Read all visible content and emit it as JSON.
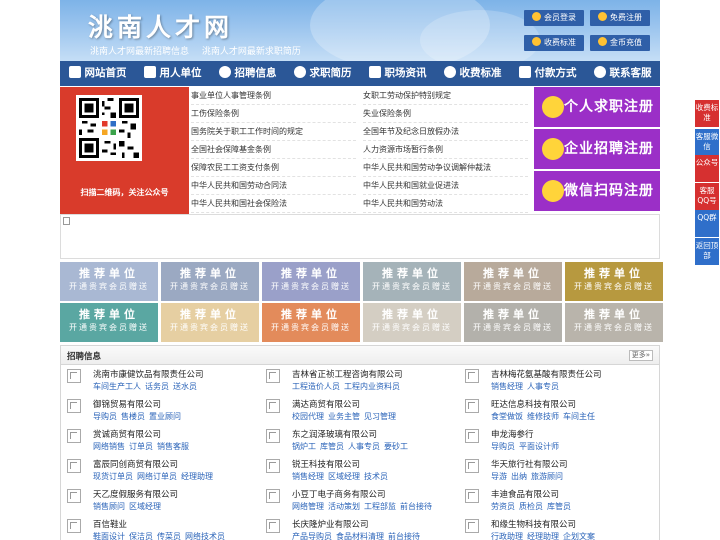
{
  "header": {
    "site_title": "洮南人才网",
    "subtitle_links": [
      "洮南人才网最新招聘信息",
      "洮南人才网最新求职简历"
    ],
    "buttons": [
      "会员登录",
      "免费注册",
      "收费标准",
      "金币充值"
    ]
  },
  "nav": {
    "items": [
      {
        "label": "网站首页",
        "icon": "home-icon"
      },
      {
        "label": "用人单位",
        "icon": "building-icon"
      },
      {
        "label": "招聘信息",
        "icon": "broadcast-icon"
      },
      {
        "label": "求职简历",
        "icon": "search-icon"
      },
      {
        "label": "职场资讯",
        "icon": "news-icon"
      },
      {
        "label": "收费标准",
        "icon": "money-icon"
      },
      {
        "label": "付款方式",
        "icon": "card-icon"
      },
      {
        "label": "联系客服",
        "icon": "phone-icon"
      }
    ]
  },
  "qr": {
    "caption": "扫描二维码，关注公众号"
  },
  "regulations": {
    "left": [
      "事业单位人事管理条例",
      "工伤保险条例",
      "国务院关于职工工作时间的规定",
      "全国社会保障基金条例",
      "保障农民工工资支付条例",
      "中华人民共和国劳动合同法",
      "中华人民共和国社会保险法"
    ],
    "right": [
      "女职工劳动保护特别规定",
      "失业保险条例",
      "全国年节及纪念日放假办法",
      "人力资源市场暂行条例",
      "中华人民共和国劳动争议调解仲裁法",
      "中华人民共和国就业促进法",
      "中华人民共和国劳动法"
    ]
  },
  "register_buttons": [
    "个人求职注册",
    "企业招聘注册",
    "微信扫码注册"
  ],
  "promo": {
    "title": "推荐单位",
    "sub": "开通贵宾会员赠送",
    "colors_row1": [
      "#a9b8d3",
      "#9ba9c2",
      "#9aa0c9",
      "#a5b3b9",
      "#b8aa9b",
      "#b7993f"
    ],
    "colors_row2": [
      "#5aa7a2",
      "#e6cfa2",
      "#e38b5b",
      "#d4cec3",
      "#b3b1ab",
      "#b9b4ab"
    ]
  },
  "recruit": {
    "title": "招聘信息",
    "more": "更多»",
    "columns": [
      [
        {
          "company": "洮南市康健饮品有限责任公司",
          "positions": [
            "车间生产工人",
            "话务员",
            "送水员"
          ]
        },
        {
          "company": "御锦贸易有限公司",
          "positions": [
            "导购员",
            "售楼员",
            "置业顾问"
          ]
        },
        {
          "company": "赏诚商贸有限公司",
          "positions": [
            "网络销售",
            "订单员",
            "销售客服"
          ]
        },
        {
          "company": "富辰同创商贸有限公司",
          "positions": [
            "现货订单员",
            "网络订单员",
            "经理助理"
          ]
        },
        {
          "company": "天乙度假服务有限公司",
          "positions": [
            "销售顾问",
            "区域经理"
          ]
        },
        {
          "company": "百信鞋业",
          "positions": [
            "鞋面设计",
            "保洁员",
            "传菜员",
            "网络技术员"
          ]
        }
      ],
      [
        {
          "company": "吉林省正祯工程咨询有限公司",
          "positions": [
            "工程造价人员",
            "工程内业资料员"
          ]
        },
        {
          "company": "满达商贸有限公司",
          "positions": [
            "校园代理",
            "业务主管",
            "见习管理"
          ]
        },
        {
          "company": "东之润泽玻璃有限公司",
          "positions": [
            "锅炉工",
            "库管员",
            "人事专员",
            "要砂工"
          ]
        },
        {
          "company": "锐王科技有限公司",
          "positions": [
            "销售经理",
            "区域经理",
            "技术员"
          ]
        },
        {
          "company": "小豆丁电子商务有限公司",
          "positions": [
            "网络管理",
            "活动策划",
            "工程部监",
            "前台接待"
          ]
        },
        {
          "company": "长庆隆炉业有限公司",
          "positions": [
            "产品导购员",
            "食品材料清理",
            "前台接待"
          ]
        }
      ],
      [
        {
          "company": "吉林梅花氨基酸有限责任公司",
          "positions": [
            "销售经理",
            "人事专员"
          ]
        },
        {
          "company": "旺达信息科技有限公司",
          "positions": [
            "食堂做饭",
            "维修技师",
            "车间主任"
          ]
        },
        {
          "company": "申龙海参行",
          "positions": [
            "导购员",
            "平面设计师"
          ]
        },
        {
          "company": "华天旅行社有限公司",
          "positions": [
            "导游",
            "出纳",
            "旅游顾问"
          ]
        },
        {
          "company": "丰迪食品有限公司",
          "positions": [
            "劳资员",
            "质检员",
            "库管员"
          ]
        },
        {
          "company": "和缘生物科技有限公司",
          "positions": [
            "行政助理",
            "经理助理",
            "企划文案"
          ]
        }
      ]
    ]
  },
  "sidebar": {
    "buttons": [
      "收费标准",
      "客服微信",
      "公众号",
      "客服QQ号",
      "QQ群",
      "返回顶部"
    ]
  }
}
